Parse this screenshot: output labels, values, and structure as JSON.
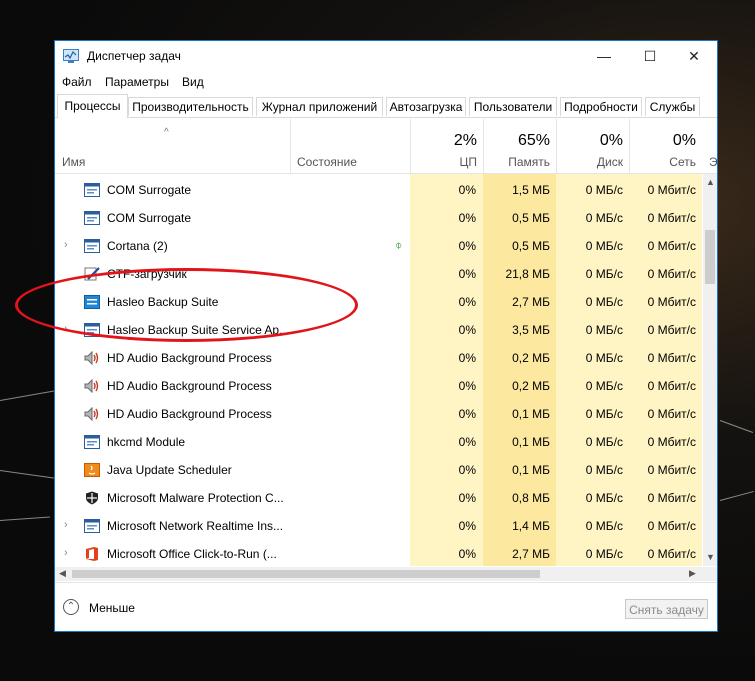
{
  "window": {
    "title": "Диспетчер задач",
    "minimize": "—",
    "maximize": "☐",
    "close": "✕"
  },
  "menu": [
    "Файл",
    "Параметры",
    "Вид"
  ],
  "tabs": [
    "Процессы",
    "Производительность",
    "Журнал приложений",
    "Автозагрузка",
    "Пользователи",
    "Подробности",
    "Службы"
  ],
  "columns": {
    "sort_indicator": "^",
    "name": "Имя",
    "status": "Состояние",
    "cpu": {
      "pct": "2%",
      "label": "ЦП"
    },
    "memory": {
      "pct": "65%",
      "label": "Память"
    },
    "disk": {
      "pct": "0%",
      "label": "Диск"
    },
    "network": {
      "pct": "0%",
      "label": "Сеть"
    },
    "more": "Э"
  },
  "processes": [
    {
      "expand": "",
      "icon": "window-icon",
      "name": "COM Surrogate",
      "status": "",
      "cpu": "0%",
      "memory": "1,5 МБ",
      "disk": "0 МБ/с",
      "network": "0 Мбит/с"
    },
    {
      "expand": "",
      "icon": "window-icon",
      "name": "COM Surrogate",
      "status": "",
      "cpu": "0%",
      "memory": "0,5 МБ",
      "disk": "0 МБ/с",
      "network": "0 Мбит/с"
    },
    {
      "expand": "›",
      "icon": "window-icon",
      "name": "Cortana (2)",
      "status": "",
      "cpu": "0%",
      "memory": "0,5 МБ",
      "disk": "0 МБ/с",
      "network": "0 Мбит/с"
    },
    {
      "expand": "",
      "icon": "pen-icon",
      "name": "CTF-загрузчик",
      "status": "",
      "cpu": "0%",
      "memory": "21,8 МБ",
      "disk": "0 МБ/с",
      "network": "0 Мбит/с"
    },
    {
      "expand": "",
      "icon": "backup-app-icon",
      "name": "Hasleo Backup Suite",
      "status": "",
      "cpu": "0%",
      "memory": "2,7 МБ",
      "disk": "0 МБ/с",
      "network": "0 Мбит/с"
    },
    {
      "expand": "›",
      "icon": "window-icon",
      "name": "Hasleo Backup Suite Service Ap...",
      "status": "",
      "cpu": "0%",
      "memory": "3,5 МБ",
      "disk": "0 МБ/с",
      "network": "0 Мбит/с"
    },
    {
      "expand": "",
      "icon": "speaker-icon",
      "name": "HD Audio Background Process",
      "status": "",
      "cpu": "0%",
      "memory": "0,2 МБ",
      "disk": "0 МБ/с",
      "network": "0 Мбит/с"
    },
    {
      "expand": "",
      "icon": "speaker-icon",
      "name": "HD Audio Background Process",
      "status": "",
      "cpu": "0%",
      "memory": "0,2 МБ",
      "disk": "0 МБ/с",
      "network": "0 Мбит/с"
    },
    {
      "expand": "",
      "icon": "speaker-icon",
      "name": "HD Audio Background Process",
      "status": "",
      "cpu": "0%",
      "memory": "0,1 МБ",
      "disk": "0 МБ/с",
      "network": "0 Мбит/с"
    },
    {
      "expand": "",
      "icon": "window-icon",
      "name": "hkcmd Module",
      "status": "",
      "cpu": "0%",
      "memory": "0,1 МБ",
      "disk": "0 МБ/с",
      "network": "0 Мбит/с"
    },
    {
      "expand": "",
      "icon": "java-icon",
      "name": "Java Update Scheduler",
      "status": "",
      "cpu": "0%",
      "memory": "0,1 МБ",
      "disk": "0 МБ/с",
      "network": "0 Мбит/с"
    },
    {
      "expand": "",
      "icon": "shield-icon",
      "name": "Microsoft Malware Protection C...",
      "status": "",
      "cpu": "0%",
      "memory": "0,8 МБ",
      "disk": "0 МБ/с",
      "network": "0 Мбит/с"
    },
    {
      "expand": "›",
      "icon": "window-icon",
      "name": "Microsoft Network Realtime Ins...",
      "status": "",
      "cpu": "0%",
      "memory": "1,4 МБ",
      "disk": "0 МБ/с",
      "network": "0 Мбит/с"
    },
    {
      "expand": "›",
      "icon": "office-icon",
      "name": "Microsoft Office Click-to-Run (...",
      "status": "",
      "cpu": "0%",
      "memory": "2,7 МБ",
      "disk": "0 МБ/с",
      "network": "0 Мбит/с"
    }
  ],
  "status_leaf_row": 2,
  "footer": {
    "less_label": "Меньше",
    "end_task_label": "Снять задачу"
  },
  "colors": {
    "accent_border": "#1a74c9",
    "cpu_fill": "#fff4c4",
    "memory_fill": "#fce89e",
    "annotation": "#e1141a"
  }
}
